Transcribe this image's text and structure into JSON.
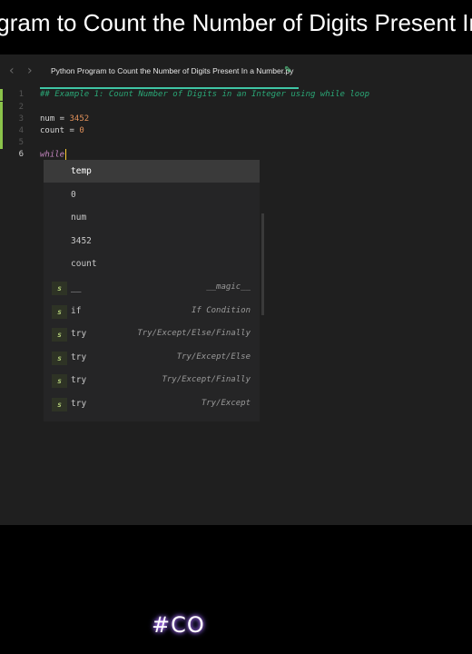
{
  "banner": {
    "title": "Python Program to Count the Number of Digits Present In a Number"
  },
  "editor": {
    "nav": {
      "back_icon": "chevron-left-icon",
      "forward_icon": "chevron-right-icon"
    },
    "tab": {
      "filename": "Python Program to Count the Number of Digits Present In a Number.py",
      "icon": "pencil-icon"
    },
    "lines": [
      {
        "number": "1",
        "parts": [
          {
            "type": "comment",
            "text": "## Example 1: Count Number of Digits in an Integer using while loop"
          }
        ]
      },
      {
        "number": "2",
        "parts": []
      },
      {
        "number": "3",
        "parts": [
          {
            "type": "plain",
            "text": "num = "
          },
          {
            "type": "num",
            "text": "3452"
          }
        ]
      },
      {
        "number": "4",
        "parts": [
          {
            "type": "plain",
            "text": "count = "
          },
          {
            "type": "num",
            "text": "0"
          }
        ]
      },
      {
        "number": "5",
        "parts": []
      },
      {
        "number": "6",
        "parts": [
          {
            "type": "kw",
            "text": "while"
          }
        ]
      }
    ],
    "active_line": "6"
  },
  "autocomplete": {
    "items": [
      {
        "label": "temp",
        "badge": "",
        "desc": ""
      },
      {
        "label": "0",
        "badge": "",
        "desc": ""
      },
      {
        "label": "num",
        "badge": "",
        "desc": ""
      },
      {
        "label": "3452",
        "badge": "",
        "desc": ""
      },
      {
        "label": "count",
        "badge": "",
        "desc": ""
      },
      {
        "label": "__",
        "badge": "s",
        "desc": "__magic__"
      },
      {
        "label": "if",
        "badge": "s",
        "desc": "If Condition"
      },
      {
        "label": "try",
        "badge": "s",
        "desc": "Try/Except/Else/Finally"
      },
      {
        "label": "try",
        "badge": "s",
        "desc": "Try/Except/Else"
      },
      {
        "label": "try",
        "badge": "s",
        "desc": "Try/Except/Finally"
      },
      {
        "label": "try",
        "badge": "s",
        "desc": "Try/Except"
      }
    ],
    "selected_index": 0
  },
  "watermark": {
    "text": "#CO"
  },
  "colors": {
    "comment": "#2aa776",
    "number": "#e0905a",
    "keyword": "#c586c0",
    "accent": "#3fc6a5",
    "gutter_mark": "#8bc34a"
  }
}
